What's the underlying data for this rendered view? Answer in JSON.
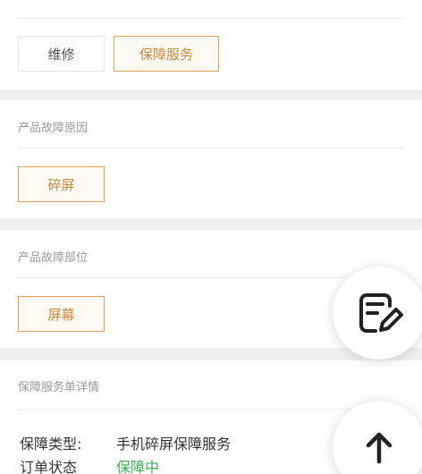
{
  "service_type": {
    "options": [
      {
        "label": "维修",
        "selected": false
      },
      {
        "label": "保障服务",
        "selected": true
      }
    ]
  },
  "fault_reason": {
    "title": "产品故障原因",
    "options": [
      {
        "label": "碎屏",
        "selected": true
      }
    ]
  },
  "fault_part": {
    "title": "产品故障部位",
    "options": [
      {
        "label": "屏幕",
        "selected": true
      }
    ]
  },
  "service_detail": {
    "title": "保障服务单详情",
    "rows": [
      {
        "label": "保障类型:",
        "value": "手机碎屏保障服务"
      },
      {
        "label": "订单状态",
        "value": "保障中",
        "value_color": "#3db054"
      }
    ]
  },
  "fab": {
    "edit_icon": "edit-note-icon",
    "top_icon": "arrow-up-icon"
  },
  "colors": {
    "accent": "#d9a05b",
    "accent_text": "#c98a3e",
    "status_green": "#3db054"
  }
}
